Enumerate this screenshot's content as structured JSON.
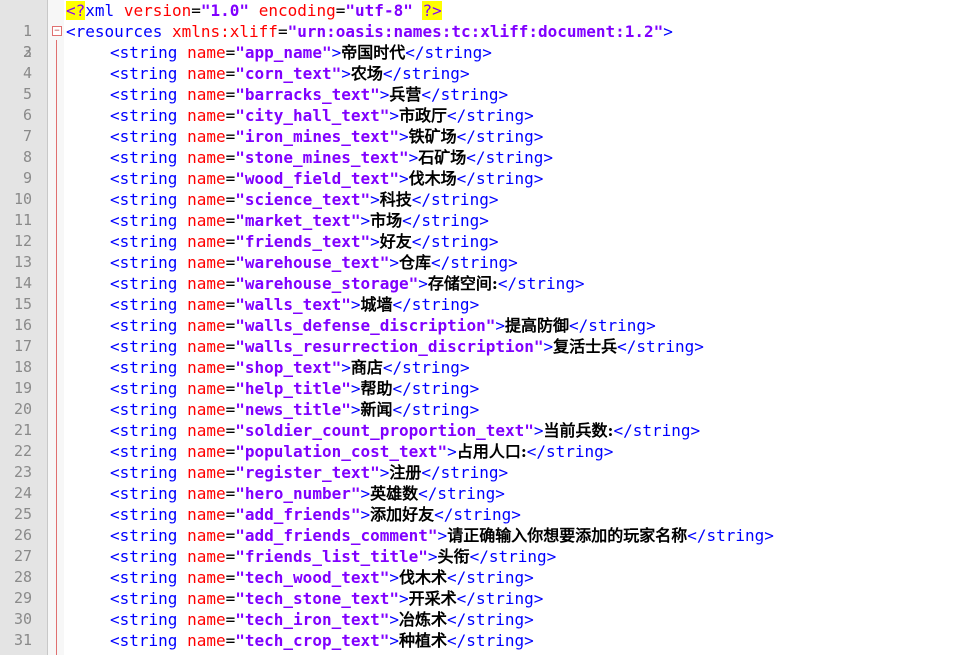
{
  "header": {
    "xml_decl": {
      "open": "<?",
      "name": "xml",
      "version_attr": "version",
      "version_val": "\"1.0\"",
      "encoding_attr": "encoding",
      "encoding_val": "\"utf-8\"",
      "close": "?>"
    },
    "resources_open": {
      "tag": "<resources",
      "attr": "xmlns:xliff",
      "eq": "=",
      "val": "\"urn:oasis:names:tc:xliff:document:1.2\"",
      "close": ">"
    }
  },
  "tokens": {
    "string_open": "<string",
    "name_attr": "name",
    "eq": "=",
    "gt": ">",
    "string_close": "</string>"
  },
  "line_numbers": [
    "1",
    "2",
    "3",
    "4",
    "5",
    "6",
    "7",
    "8",
    "9",
    "10",
    "11",
    "12",
    "13",
    "14",
    "15",
    "16",
    "17",
    "18",
    "19",
    "20",
    "21",
    "22",
    "23",
    "24",
    "25",
    "26",
    "27",
    "28",
    "29",
    "30",
    "31"
  ],
  "strings": [
    {
      "name": "\"app_name\"",
      "value": "帝国时代"
    },
    {
      "name": "\"corn_text\"",
      "value": "农场"
    },
    {
      "name": "\"barracks_text\"",
      "value": "兵营"
    },
    {
      "name": "\"city_hall_text\"",
      "value": "市政厅"
    },
    {
      "name": "\"iron_mines_text\"",
      "value": "铁矿场"
    },
    {
      "name": "\"stone_mines_text\"",
      "value": "石矿场"
    },
    {
      "name": "\"wood_field_text\"",
      "value": "伐木场"
    },
    {
      "name": "\"science_text\"",
      "value": "科技"
    },
    {
      "name": "\"market_text\"",
      "value": "市场"
    },
    {
      "name": "\"friends_text\"",
      "value": "好友"
    },
    {
      "name": "\"warehouse_text\"",
      "value": "仓库"
    },
    {
      "name": "\"warehouse_storage\"",
      "value": "存储空间:"
    },
    {
      "name": "\"walls_text\"",
      "value": "城墙"
    },
    {
      "name": "\"walls_defense_discription\"",
      "value": "提高防御"
    },
    {
      "name": "\"walls_resurrection_discription\"",
      "value": "复活士兵"
    },
    {
      "name": "\"shop_text\"",
      "value": "商店"
    },
    {
      "name": "\"help_title\"",
      "value": "帮助"
    },
    {
      "name": "\"news_title\"",
      "value": "新闻"
    },
    {
      "name": "\"soldier_count_proportion_text\"",
      "value": "当前兵数:"
    },
    {
      "name": "\"population_cost_text\"",
      "value": "占用人口:"
    },
    {
      "name": "\"register_text\"",
      "value": "注册"
    },
    {
      "name": "\"hero_number\"",
      "value": "英雄数"
    },
    {
      "name": "\"add_friends\"",
      "value": "添加好友"
    },
    {
      "name": "\"add_friends_comment\"",
      "value": "请正确输入你想要添加的玩家名称"
    },
    {
      "name": "\"friends_list_title\"",
      "value": "头衔"
    },
    {
      "name": "\"tech_wood_text\"",
      "value": "伐木术"
    },
    {
      "name": "\"tech_stone_text\"",
      "value": "开采术"
    },
    {
      "name": "\"tech_iron_text\"",
      "value": "冶炼术"
    },
    {
      "name": "\"tech_crop_text\"",
      "value": "种植术"
    }
  ],
  "colors": {
    "tag": "#0000ff",
    "attr": "#ff0000",
    "string": "#8000ff",
    "pi_highlight": "#ffff00",
    "gutter": "#e4e4e4",
    "fold_line": "#e07070"
  },
  "icons": {
    "fold": "fold-minus-icon"
  }
}
